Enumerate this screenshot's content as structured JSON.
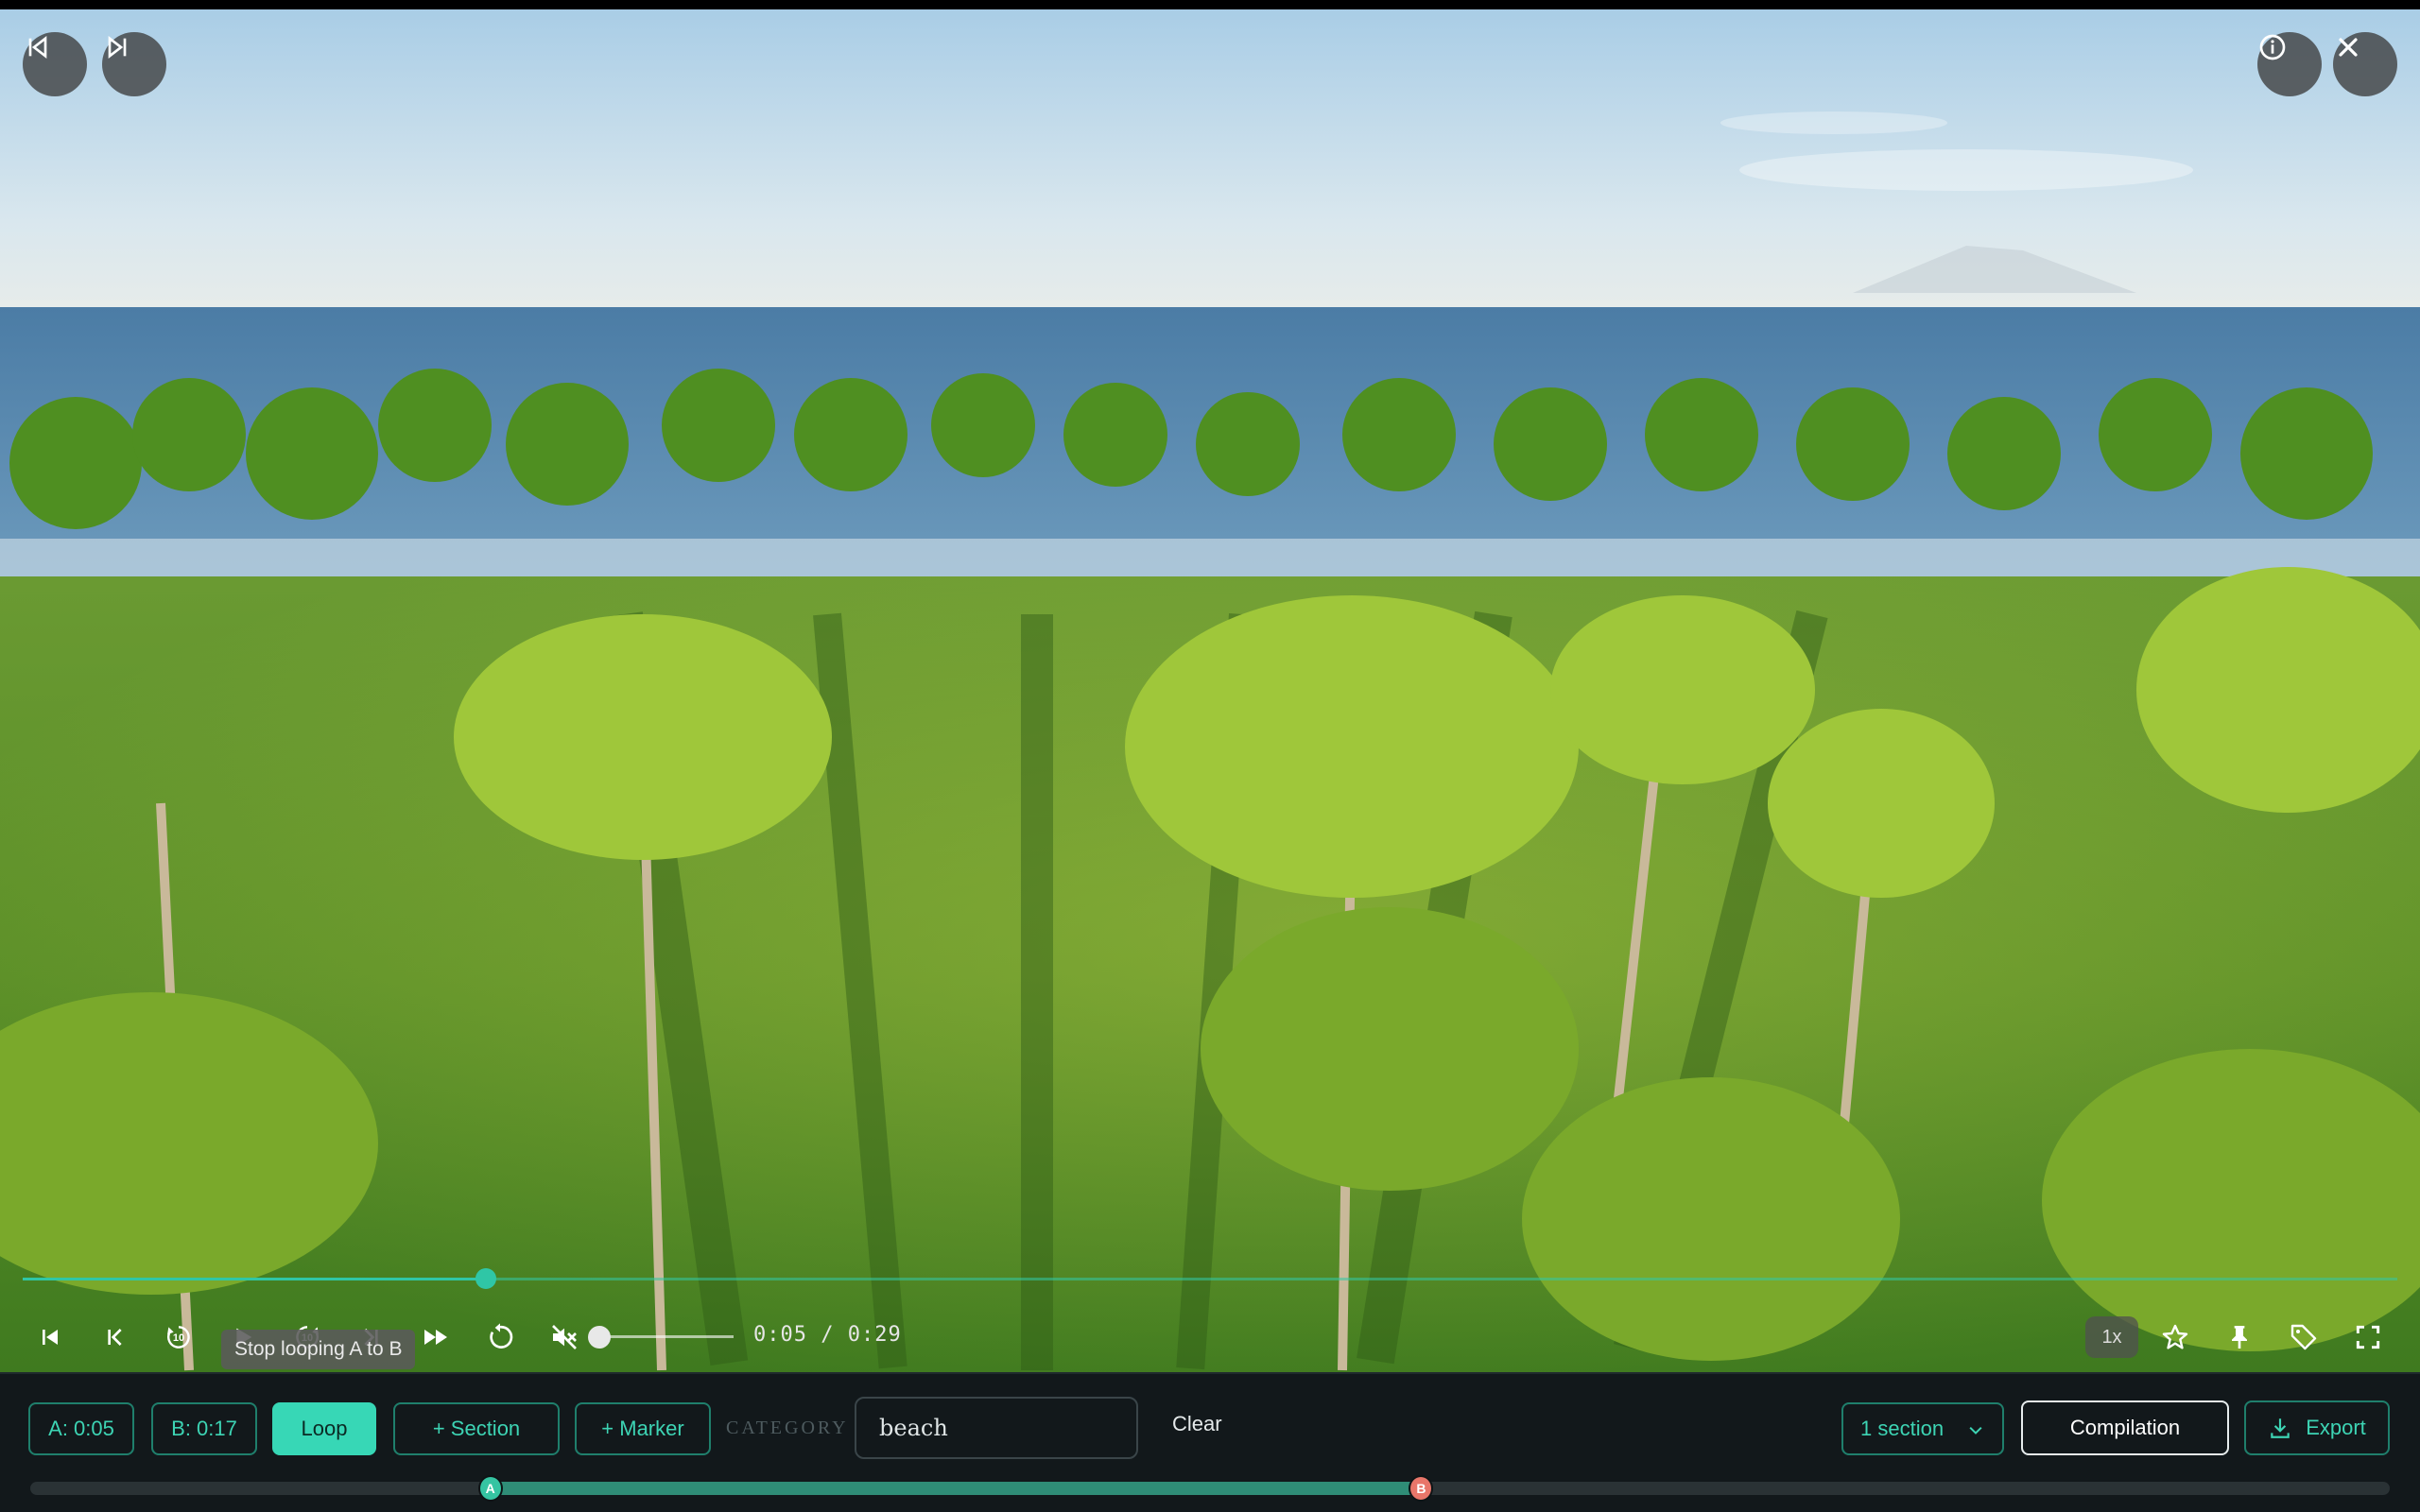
{
  "video": {
    "current_time": "0:05",
    "duration": "0:29",
    "time_display": "0:05 / 0:29",
    "progress": 0.195,
    "volume": 0.0,
    "muted": true,
    "speed": "1x",
    "tooltip": "Stop looping A to B"
  },
  "top_nav": {
    "prev_icon": "skip-previous-icon",
    "next_icon": "skip-next-icon",
    "info_icon": "info-icon",
    "close_icon": "close-icon"
  },
  "controls": {
    "icons": [
      "go-to-start-icon",
      "previous-frame-icon",
      "rewind-10-icon",
      "play-icon",
      "forward-10-icon",
      "next-frame-icon",
      "fast-forward-icon",
      "replay-icon",
      "volume-muted-icon",
      "star-icon",
      "pin-icon",
      "tag-icon",
      "fullscreen-icon"
    ],
    "rewind_label": "10",
    "forward_label": "10"
  },
  "panel": {
    "a_label": "A: 0:05",
    "b_label": "B: 0:17",
    "loop_label": "Loop",
    "section_label": "+ Section",
    "marker_label": "+ Marker",
    "category_label": "CATEGORY",
    "category_value": "beach",
    "clear_label": "Clear",
    "sections_select": "1 section",
    "compilation_label": "Compilation",
    "export_label": "Export"
  },
  "range": {
    "a_marker": "A",
    "b_marker": "B",
    "start_fraction": 0.195,
    "end_fraction": 0.5895
  },
  "colors": {
    "accent": "#2fc6a6",
    "loop_button": "#37d7b6",
    "marker_b": "#e8766a",
    "panel_bg": "#12181b"
  }
}
